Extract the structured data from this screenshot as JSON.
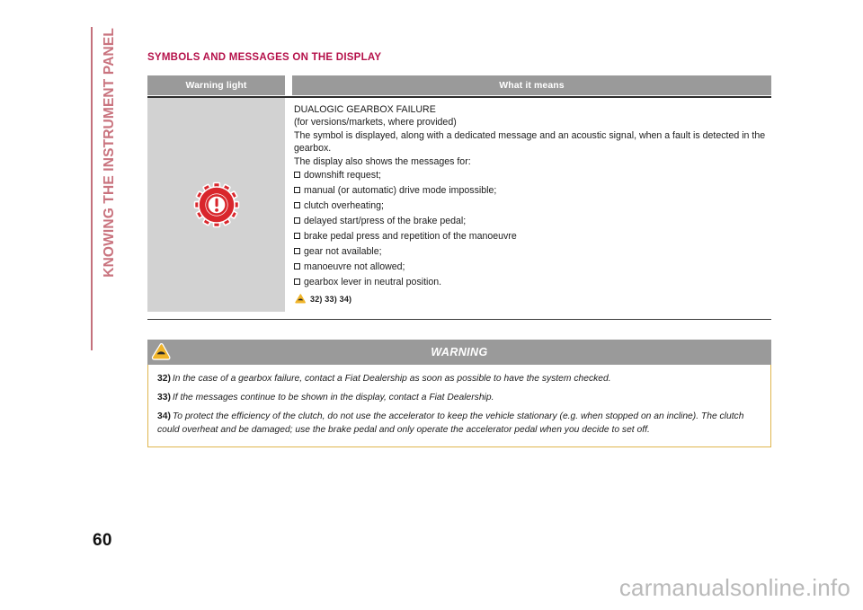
{
  "chapter": {
    "label": "KNOWING THE INSTRUMENT PANEL",
    "color": "#c9737e"
  },
  "page": {
    "number": "60",
    "watermark": "carmanualsonline.info"
  },
  "section": {
    "title": "SYMBOLS AND MESSAGES ON THE DISPLAY",
    "title_color": "#b5114a"
  },
  "warning_light_table": {
    "columns": [
      {
        "header": "Warning light"
      },
      {
        "header": "What it means"
      }
    ],
    "header_bg": "#9a9a9a",
    "symbol_cell_bg": "#d2d2d2",
    "row": {
      "symbol_icon": "gear-exclamation-icon",
      "symbol_color": "#d9262c",
      "heading": "DUALOGIC GEARBOX FAILURE",
      "subheading": "(for versions/markets, where provided)",
      "paragraphs": [
        "The symbol is displayed, along with a dedicated message and an acoustic signal, when a fault is detected in the gearbox.",
        "The display also shows the messages for:"
      ],
      "bullets": [
        "downshift request;",
        "manual (or automatic) drive mode impossible;",
        "clutch overheating;",
        "delayed start/press of the brake pedal;",
        "brake pedal press and repetition of the manoeuvre",
        "gear not available;",
        "manoeuvre not allowed;",
        "gearbox lever in neutral position."
      ],
      "reference_icon": "warning-triangle-icon",
      "references": "32) 33) 34)"
    }
  },
  "warning_block": {
    "icon": "warning-triangle-icon",
    "title": "WARNING",
    "border_color": "#e0b64e",
    "notes": [
      {
        "number": "32)",
        "text": "In the case of a gearbox failure, contact a Fiat Dealership as soon as possible to have the system checked."
      },
      {
        "number": "33)",
        "text": "If the messages continue to be shown in the display, contact a Fiat Dealership."
      },
      {
        "number": "34)",
        "text": "To protect the efficiency of the clutch, do not use the accelerator to keep the vehicle stationary (e.g. when stopped on an incline). The clutch could overheat and be damaged; use the brake pedal and only operate the accelerator pedal when you decide to set off."
      }
    ]
  }
}
